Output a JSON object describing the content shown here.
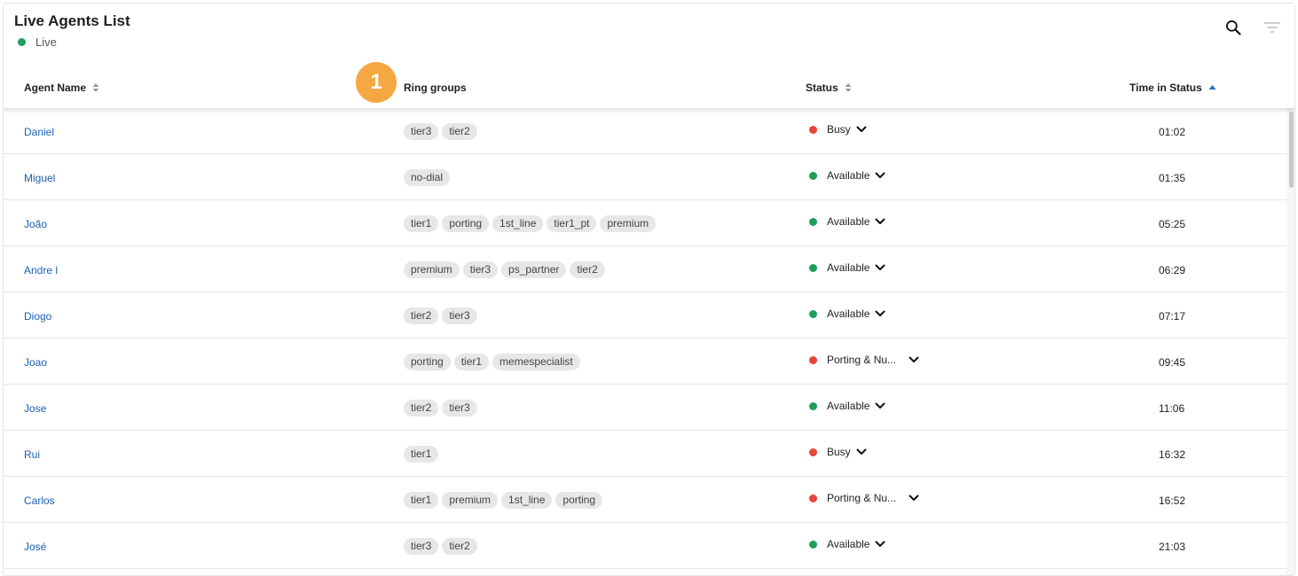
{
  "colors": {
    "live": "#1e9e5a",
    "available": "#1e9e5a",
    "busy": "#e8453c",
    "link": "#1a5fb4",
    "accent_sort": "#1a73c8",
    "badge": "#f5a742"
  },
  "header": {
    "title": "Live Agents List",
    "live_label": "Live",
    "search_icon": "search-icon",
    "filter_icon": "filter-icon"
  },
  "badge": {
    "number": "1"
  },
  "columns": {
    "agent_name": "Agent Name",
    "ring_groups": "Ring groups",
    "status": "Status",
    "time_in_status": "Time in Status"
  },
  "rows": [
    {
      "agent": "Daniel",
      "groups": [
        "tier3",
        "tier2"
      ],
      "status": "Busy",
      "status_kind": "busy",
      "time": "01:02"
    },
    {
      "agent": "Miguel",
      "groups": [
        "no-dial"
      ],
      "status": "Available",
      "status_kind": "available",
      "time": "01:35"
    },
    {
      "agent": "João",
      "groups": [
        "tier1",
        "porting",
        "1st_line",
        "tier1_pt",
        "premium"
      ],
      "status": "Available",
      "status_kind": "available",
      "time": "05:25"
    },
    {
      "agent": "Andre l",
      "groups": [
        "premium",
        "tier3",
        "ps_partner",
        "tier2"
      ],
      "status": "Available",
      "status_kind": "available",
      "time": "06:29"
    },
    {
      "agent": "Diogo",
      "groups": [
        "tier2",
        "tier3"
      ],
      "status": "Available",
      "status_kind": "available",
      "time": "07:17"
    },
    {
      "agent": "Joao",
      "groups": [
        "porting",
        "tier1",
        "memespecialist"
      ],
      "status": "Porting & Nu...",
      "status_kind": "busy",
      "time": "09:45"
    },
    {
      "agent": "Jose",
      "groups": [
        "tier2",
        "tier3"
      ],
      "status": "Available",
      "status_kind": "available",
      "time": "11:06"
    },
    {
      "agent": "Rui",
      "groups": [
        "tier1"
      ],
      "status": "Busy",
      "status_kind": "busy",
      "time": "16:32"
    },
    {
      "agent": "Carlos",
      "groups": [
        "tier1",
        "premium",
        "1st_line",
        "porting"
      ],
      "status": "Porting & Nu...",
      "status_kind": "busy",
      "time": "16:52"
    },
    {
      "agent": "José",
      "groups": [
        "tier3",
        "tier2"
      ],
      "status": "Available",
      "status_kind": "available",
      "time": "21:03"
    }
  ]
}
